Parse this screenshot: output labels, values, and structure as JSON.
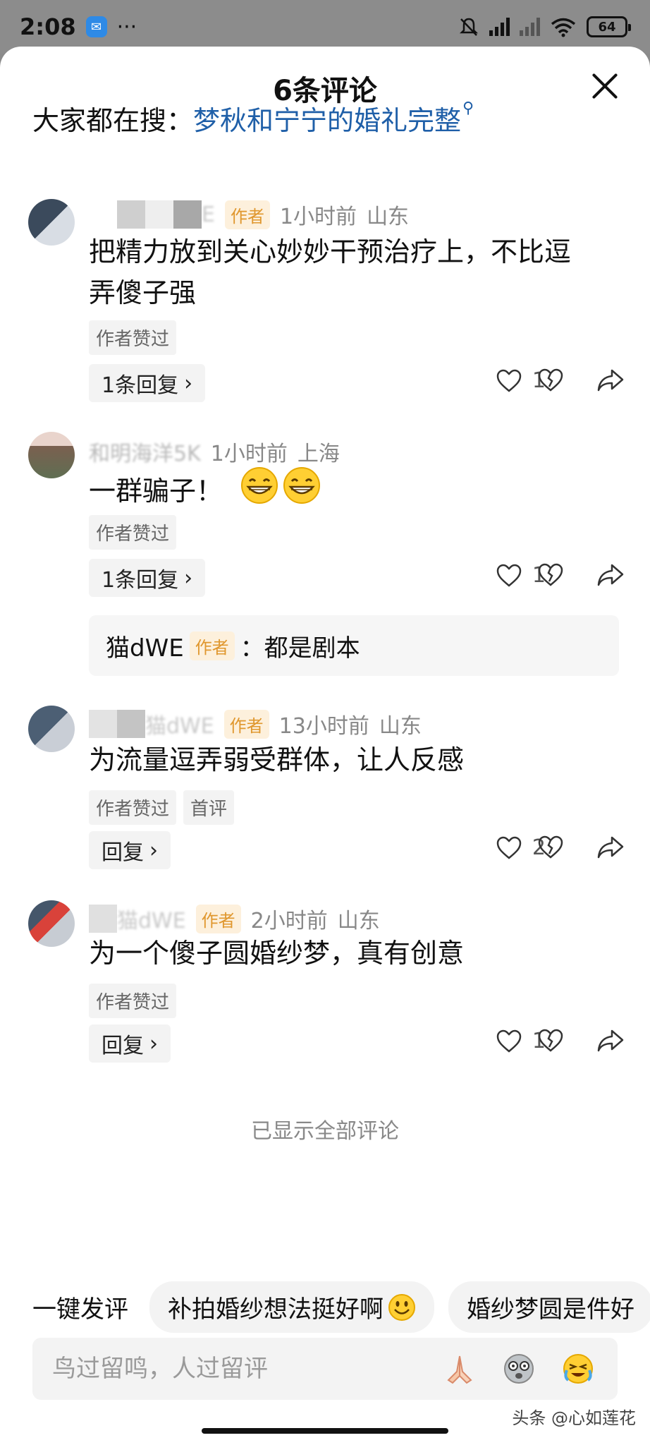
{
  "status_bar": {
    "time": "2:08",
    "dots": "···",
    "battery": "64"
  },
  "header": {
    "title": "6条评论"
  },
  "search": {
    "label": "大家都在搜：",
    "query": "梦秋和宁宁的婚礼完整"
  },
  "comments": [
    {
      "name_fragment": "E",
      "badge": "作者",
      "time": "1小时前",
      "location": "山东",
      "text_line1": "把精力放到关心妙妙干预治疗上，不比逗",
      "text_line2": "弄傻子强",
      "tags": [
        "作者赞过"
      ],
      "reply_label": "1条回复",
      "likes": "1"
    },
    {
      "name_fragment": "和明海洋5K",
      "time": "1小时前",
      "location": "上海",
      "text": "一群骗子！",
      "tags": [
        "作者赞过"
      ],
      "reply_label": "1条回复",
      "likes": "1",
      "sub_reply": {
        "name": "猫dWE",
        "badge": "作者",
        "text": "：都是剧本"
      }
    },
    {
      "name_fragment": "猫dWE",
      "badge": "作者",
      "time": "13小时前",
      "location": "山东",
      "text": "为流量逗弄弱受群体，让人反感",
      "tags": [
        "作者赞过",
        "首评"
      ],
      "reply_label": "回复",
      "likes": "2"
    },
    {
      "name_fragment": "猫dWE",
      "badge": "作者",
      "time": "2小时前",
      "location": "山东",
      "text": "为一个傻子圆婚纱梦，真有创意",
      "tags": [
        "作者赞过"
      ],
      "reply_label": "回复",
      "likes": "1"
    }
  ],
  "footer": {
    "all_shown": "已显示全部评论",
    "quick_label": "一键发评",
    "quick_chips": [
      "补拍婚纱想法挺好啊",
      "婚纱梦圆是件好"
    ],
    "input_placeholder": "鸟过留鸣，人过留评",
    "watermark": "头条 @心如莲花"
  },
  "colors": {
    "link": "#1f5fa8",
    "author_badge_bg": "#fdf0dc",
    "author_badge_fg": "#e0972e"
  }
}
